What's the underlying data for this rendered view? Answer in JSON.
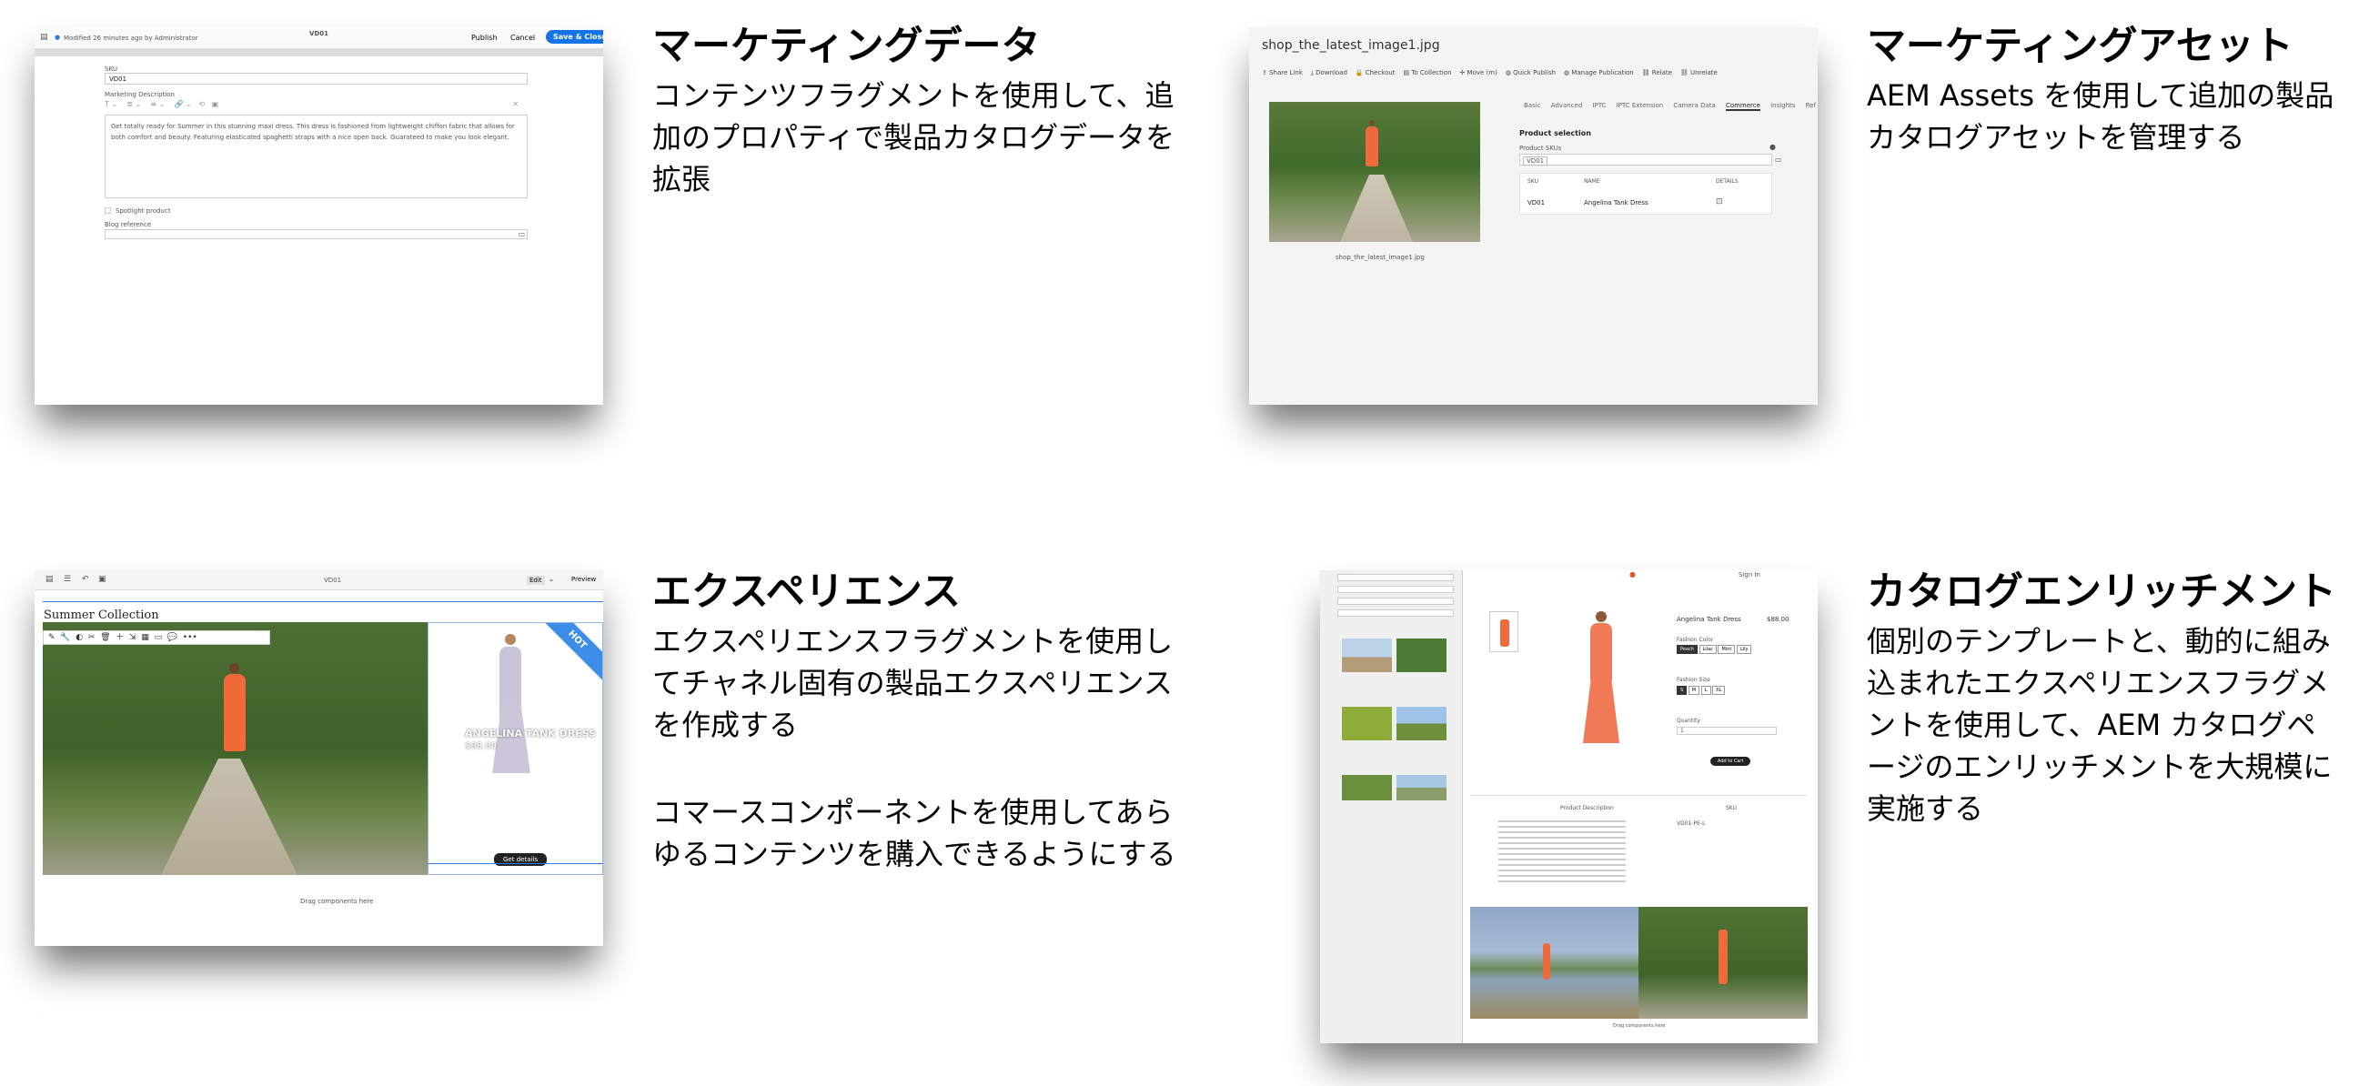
{
  "panels": [
    {
      "title": "マーケティングデータ",
      "text": "コンテンツフラグメントを使用して、追加のプロパティで製品カタログデータを拡張"
    },
    {
      "title": "マーケティングアセット",
      "text": "AEM Assets を使用して追加の製品カタログアセットを管理する"
    },
    {
      "title": "エクスペリエンス",
      "text": "エクスペリエンスフラグメントを使用してチャネル固有の製品エクスペリエンスを作成する",
      "text2": "コマースコンポーネントを使用してあらゆるコンテンツを購入できるようにする"
    },
    {
      "title": "カタログエンリッチメント",
      "text": "個別のテンプレートと、動的に組み込まれたエクスペリエンスフラグメントを使用して、AEM カタログページのエンリッチメントを大規模に実施する"
    }
  ],
  "cf": {
    "modified": "Modified 26 minutes ago by Administrator",
    "name": "VD01",
    "publish": "Publish",
    "cancel": "Cancel",
    "save": "Save & Close",
    "sku_label": "SKU",
    "sku_value": "VD01",
    "desc_label": "Marketing Description",
    "desc": "Get totally ready for Summer in this stunning maxi dress. This dress is fashioned from lightweight chiffon fabric that allows for both comfort and beauty. Featuring elasticated spaghetti straps with a nice open back. Guarateed to make you look elegant.",
    "spotlight": "Spotlight product",
    "blog": "Blog reference"
  },
  "asset": {
    "filename": "shop_the_latest_image1.jpg",
    "toolbar": [
      "Share Link",
      "Download",
      "Checkout",
      "To Collection",
      "Move (m)",
      "Quick Publish",
      "Manage Publication",
      "Relate",
      "Unrelate"
    ],
    "tabs": [
      "Basic",
      "Advanced",
      "IPTC",
      "IPTC Extension",
      "Camera Data",
      "Commerce",
      "Insights",
      "Ref"
    ],
    "section": "Product selection",
    "skus_label": "Product SKUs",
    "sku_tag": "VD01",
    "cols": [
      "SKU",
      "NAME",
      "DETAILS"
    ],
    "row": {
      "sku": "VD01",
      "name": "Angelina Tank Dress"
    },
    "caption": "shop_the_latest_image1.jpg"
  },
  "xf": {
    "name": "VD01",
    "edit": "Edit",
    "preview": "Preview",
    "heading": "Summer Collection",
    "badge": "HOT",
    "product": "ANGELINA TANK DRESS",
    "price": "$88.00",
    "cta": "Get details",
    "drag": "Drag components here"
  },
  "pdp": {
    "product": "Angelina Tank Dress",
    "price": "$88.00",
    "color_label": "Fashion Color",
    "colors": [
      "Peach",
      "Lilac",
      "Mint",
      "Lily"
    ],
    "size_label": "Fashion Size",
    "sizes": [
      "S",
      "M",
      "L",
      "XL"
    ],
    "qty_label": "Quantity",
    "qty": "1",
    "add": "Add to Cart",
    "desc_title": "Product Description",
    "sku_title": "SKU",
    "sku": "VD01-PE-L",
    "signin": "Sign In",
    "drag": "Drag components here"
  }
}
